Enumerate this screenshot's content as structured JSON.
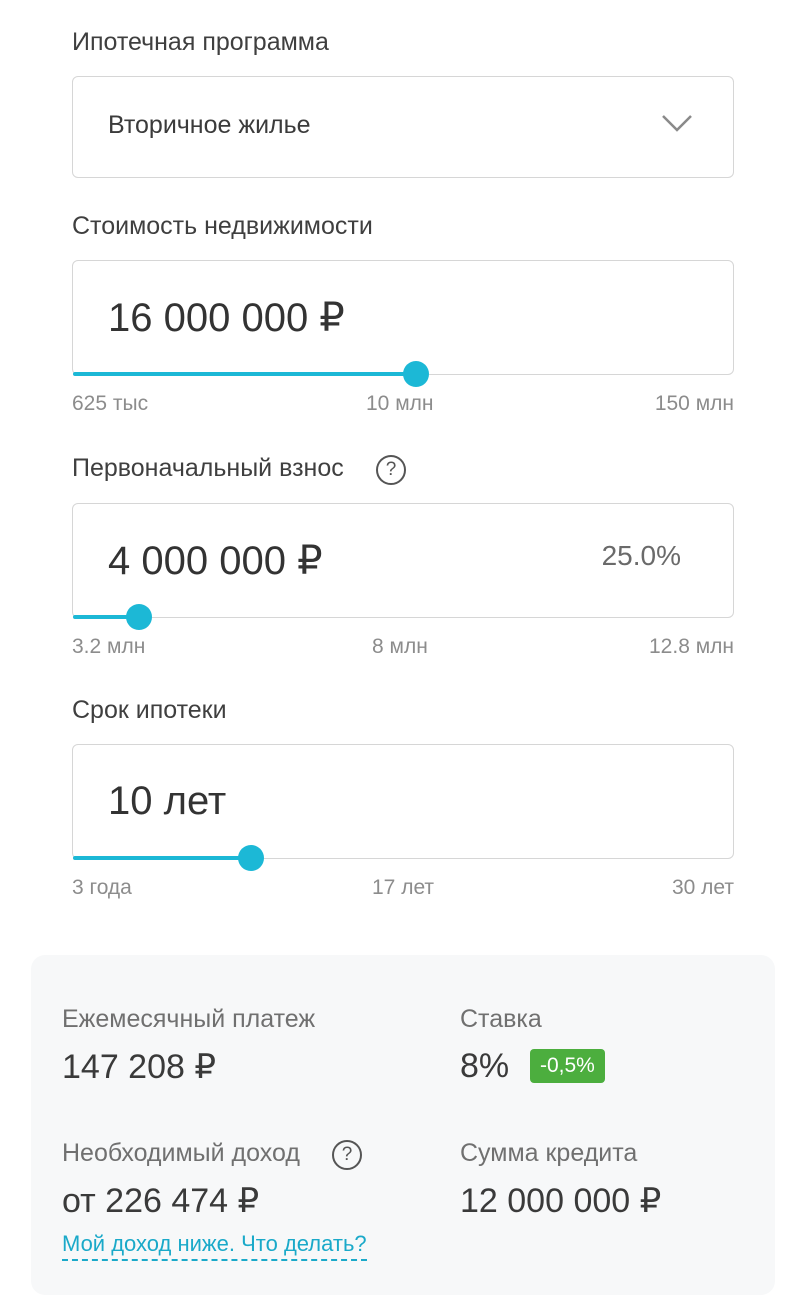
{
  "program": {
    "label": "Ипотечная программа",
    "value": "Вторичное жилье",
    "icon": "chevron-down-icon"
  },
  "property_cost": {
    "label": "Стоимость недвижимости",
    "value": "16 000 000 ₽",
    "slider_fraction": 0.52,
    "ticks": [
      "625 тыс",
      "10 млн",
      "150 млн"
    ]
  },
  "down_payment": {
    "label": "Первоначальный взнос",
    "help_icon": "?",
    "value": "4 000 000 ₽",
    "percent": "25.0%",
    "slider_fraction": 0.1,
    "ticks": [
      "3.2 млн",
      "8 млн",
      "12.8 млн"
    ]
  },
  "term": {
    "label": "Срок ипотеки",
    "value": "10 лет",
    "slider_fraction": 0.27,
    "ticks": [
      "3 года",
      "17 лет",
      "30 лет"
    ]
  },
  "results": {
    "monthly_label": "Ежемесячный платеж",
    "monthly_value": "147 208 ₽",
    "rate_label": "Ставка",
    "rate_value": "8%",
    "rate_badge": "-0,5%",
    "income_label": "Необходимый доход",
    "income_help_icon": "?",
    "income_value": "от 226 474 ₽",
    "loan_label": "Сумма кредита",
    "loan_value": "12 000 000 ₽",
    "income_link": "Мой доход ниже. Что делать?"
  },
  "colors": {
    "accent": "#1cb8d6",
    "badge_green": "#4cae3e"
  }
}
